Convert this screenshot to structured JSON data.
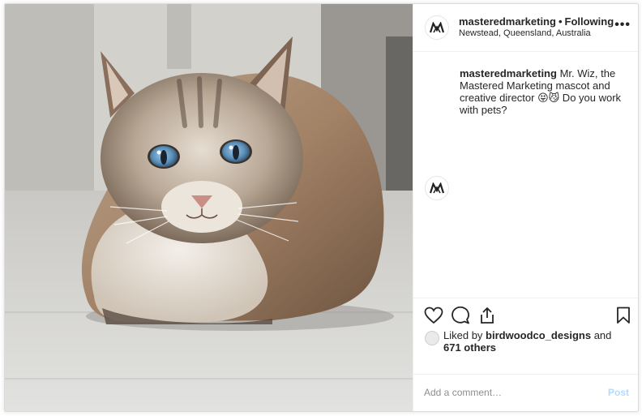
{
  "post": {
    "username": "masteredmarketing",
    "separator": "•",
    "follow_status": "Following",
    "location": "Newstead, Queensland, Australia",
    "more_label": "•••",
    "caption_user": "masteredmarketing",
    "caption_text": "Mr. Wiz, the Mastered Marketing mascot and creative director 😝😼 Do you work with pets?",
    "liked_by_prefix": "Liked by",
    "liked_by_user": "birdwoodco_designs",
    "liked_by_and": "and",
    "others_count": "671 others",
    "comment_placeholder": "Add a comment…",
    "post_label": "Post"
  },
  "icons": {
    "avatar": "mm-logo-avatar",
    "more": "more-options-icon",
    "like": "heart-icon",
    "comment": "comment-icon",
    "share": "share-icon",
    "save": "bookmark-icon"
  },
  "colors": {
    "text": "#262626",
    "muted": "#8e8e8e",
    "border": "#efefef",
    "post_button_disabled": "#b3dbff"
  }
}
